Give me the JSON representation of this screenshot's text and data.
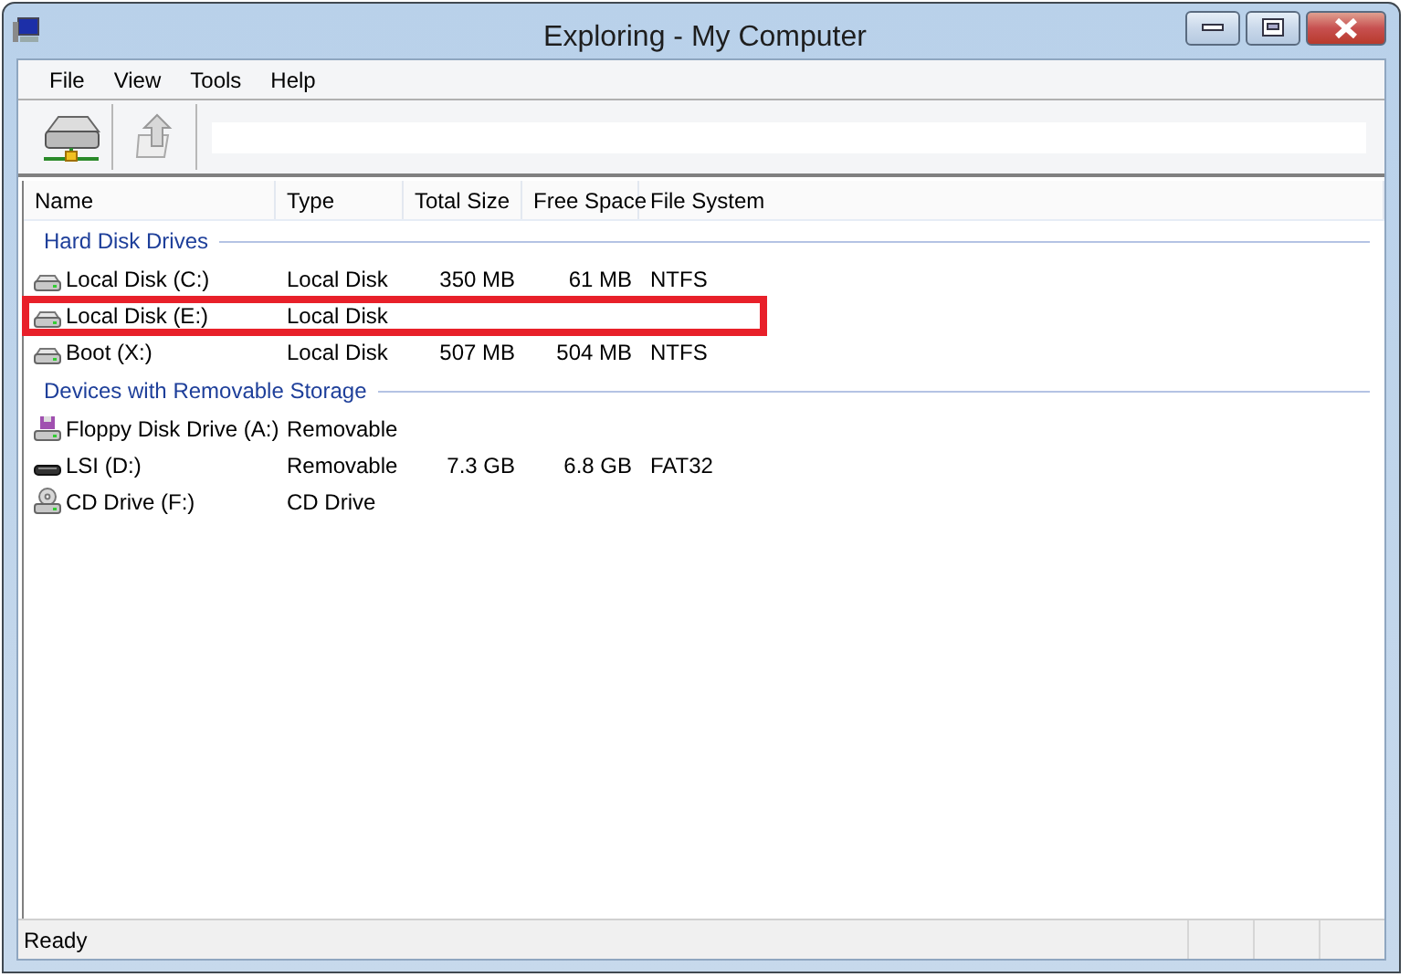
{
  "window": {
    "title": "Exploring - My Computer"
  },
  "menu": [
    "File",
    "View",
    "Tools",
    "Help"
  ],
  "columns": [
    "Name",
    "Type",
    "Total Size",
    "Free Space",
    "File System"
  ],
  "groups": [
    {
      "title": "Hard Disk Drives",
      "items": [
        {
          "kind": "disk",
          "name": "Local Disk (C:)",
          "type": "Local Disk",
          "total": "350 MB",
          "free": "61 MB",
          "fs": "NTFS",
          "highlighted": false
        },
        {
          "kind": "disk",
          "name": "Local Disk (E:)",
          "type": "Local Disk",
          "highlighted": true
        },
        {
          "kind": "disk",
          "name": "Boot (X:)",
          "type": "Local Disk",
          "total": "507 MB",
          "free": "504 MB",
          "fs": "NTFS",
          "highlighted": false
        }
      ]
    },
    {
      "title": "Devices with Removable Storage",
      "items": [
        {
          "kind": "floppy",
          "name": "Floppy Disk Drive (A:)",
          "type": "Removable",
          "highlighted": false
        },
        {
          "kind": "usb",
          "name": "LSI (D:)",
          "type": "Removable",
          "total": "7.3 GB",
          "free": "6.8 GB",
          "fs": "FAT32",
          "highlighted": false
        },
        {
          "kind": "cd",
          "name": "CD Drive (F:)",
          "type": "CD Drive",
          "highlighted": false
        }
      ]
    }
  ],
  "status_bar": "Ready"
}
